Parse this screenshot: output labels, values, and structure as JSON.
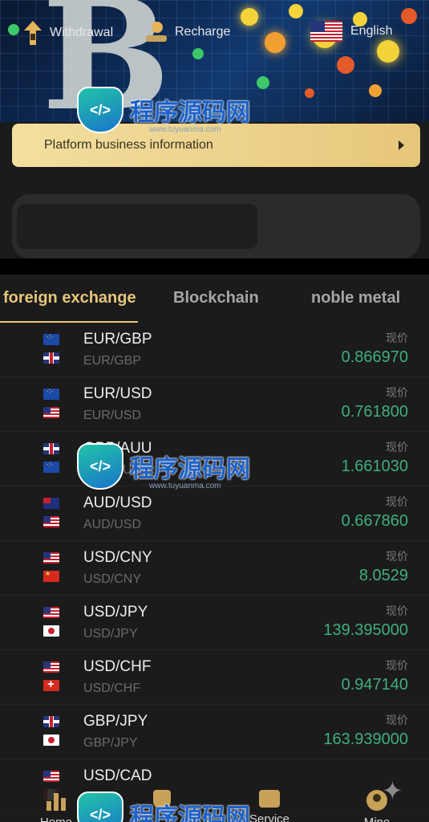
{
  "banner": {
    "notice_text": "Platform business information"
  },
  "actions": {
    "withdrawal": "Withdrawal",
    "recharge": "Recharge",
    "language": "English"
  },
  "tabs": [
    {
      "label": "foreign exchange",
      "active": true
    },
    {
      "label": "Blockchain",
      "active": false
    },
    {
      "label": "noble metal",
      "active": false
    }
  ],
  "price_label": "现价",
  "rows": [
    {
      "pair": "EUR/GBP",
      "sub": "EUR/GBP",
      "price": "0.866970",
      "flags": [
        "eu",
        "gb"
      ]
    },
    {
      "pair": "EUR/USD",
      "sub": "EUR/USD",
      "price": "0.761800",
      "flags": [
        "eu",
        "us"
      ]
    },
    {
      "pair": "GBP/AUU",
      "sub": "GBP/AUU",
      "price": "1.661030",
      "flags": [
        "gb",
        "eu"
      ]
    },
    {
      "pair": "AUD/USD",
      "sub": "AUD/USD",
      "price": "0.667860",
      "flags": [
        "au",
        "us"
      ]
    },
    {
      "pair": "USD/CNY",
      "sub": "USD/CNY",
      "price": "8.0529",
      "flags": [
        "us",
        "cn"
      ]
    },
    {
      "pair": "USD/JPY",
      "sub": "USD/JPY",
      "price": "139.395000",
      "flags": [
        "us",
        "jp"
      ]
    },
    {
      "pair": "USD/CHF",
      "sub": "USD/CHF",
      "price": "0.947140",
      "flags": [
        "us",
        "ch"
      ]
    },
    {
      "pair": "GBP/JPY",
      "sub": "GBP/JPY",
      "price": "163.939000",
      "flags": [
        "gb",
        "jp"
      ]
    },
    {
      "pair": "USD/CAD",
      "sub": "",
      "price": "",
      "flags": [
        "us",
        "ca"
      ]
    }
  ],
  "nav": [
    {
      "label": "Home",
      "icon": "bar-chart-icon"
    },
    {
      "label": "",
      "icon": "trophy-icon"
    },
    {
      "label": "Service",
      "icon": "chat-icon"
    },
    {
      "label": "Mine",
      "icon": "user-icon"
    }
  ],
  "watermark": {
    "text": "程序源码网",
    "url": "www.tuyuanma.com",
    "badge": "</>"
  },
  "colors": {
    "accent_gold": "#e6c67a",
    "price_green": "#3fae7e",
    "background": "#1b1b1b"
  }
}
